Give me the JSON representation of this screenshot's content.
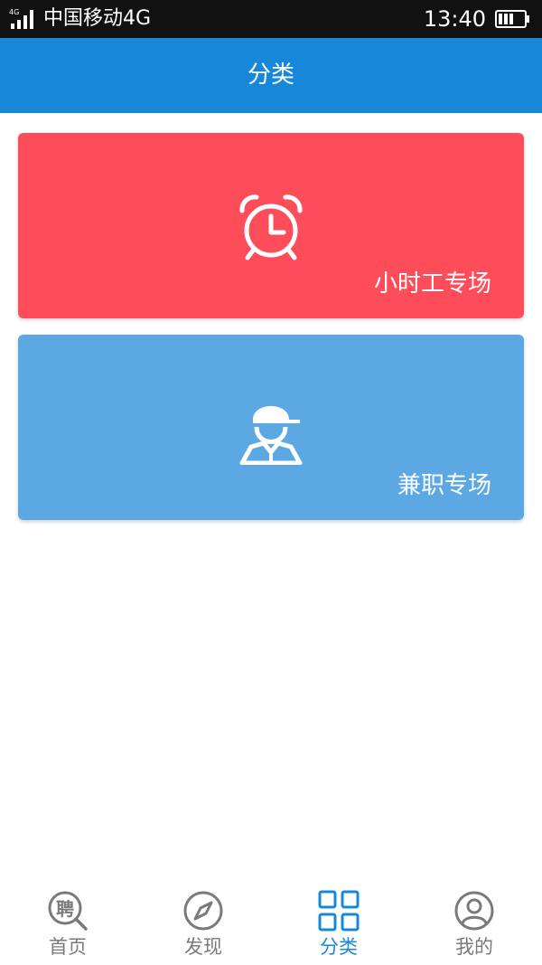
{
  "status_bar": {
    "network": "4G",
    "carrier": "中国移动4G",
    "time": "13:40"
  },
  "header": {
    "title": "分类"
  },
  "categories": [
    {
      "label": "小时工专场",
      "icon": "alarm-clock-icon",
      "color": "#fd4d5b"
    },
    {
      "label": "兼职专场",
      "icon": "worker-cap-icon",
      "color": "#5ba8e2"
    }
  ],
  "tabs": [
    {
      "label": "首页",
      "icon": "search-hire-icon",
      "glyph": "聘",
      "active": false
    },
    {
      "label": "发现",
      "icon": "compass-icon",
      "active": false
    },
    {
      "label": "分类",
      "icon": "grid-icon",
      "active": true
    },
    {
      "label": "我的",
      "icon": "profile-icon",
      "active": false
    }
  ],
  "colors": {
    "header": "#1788d9",
    "status_bar": "#111111",
    "tab_active": "#1788d9",
    "tab_inactive": "#7a7a7a"
  }
}
